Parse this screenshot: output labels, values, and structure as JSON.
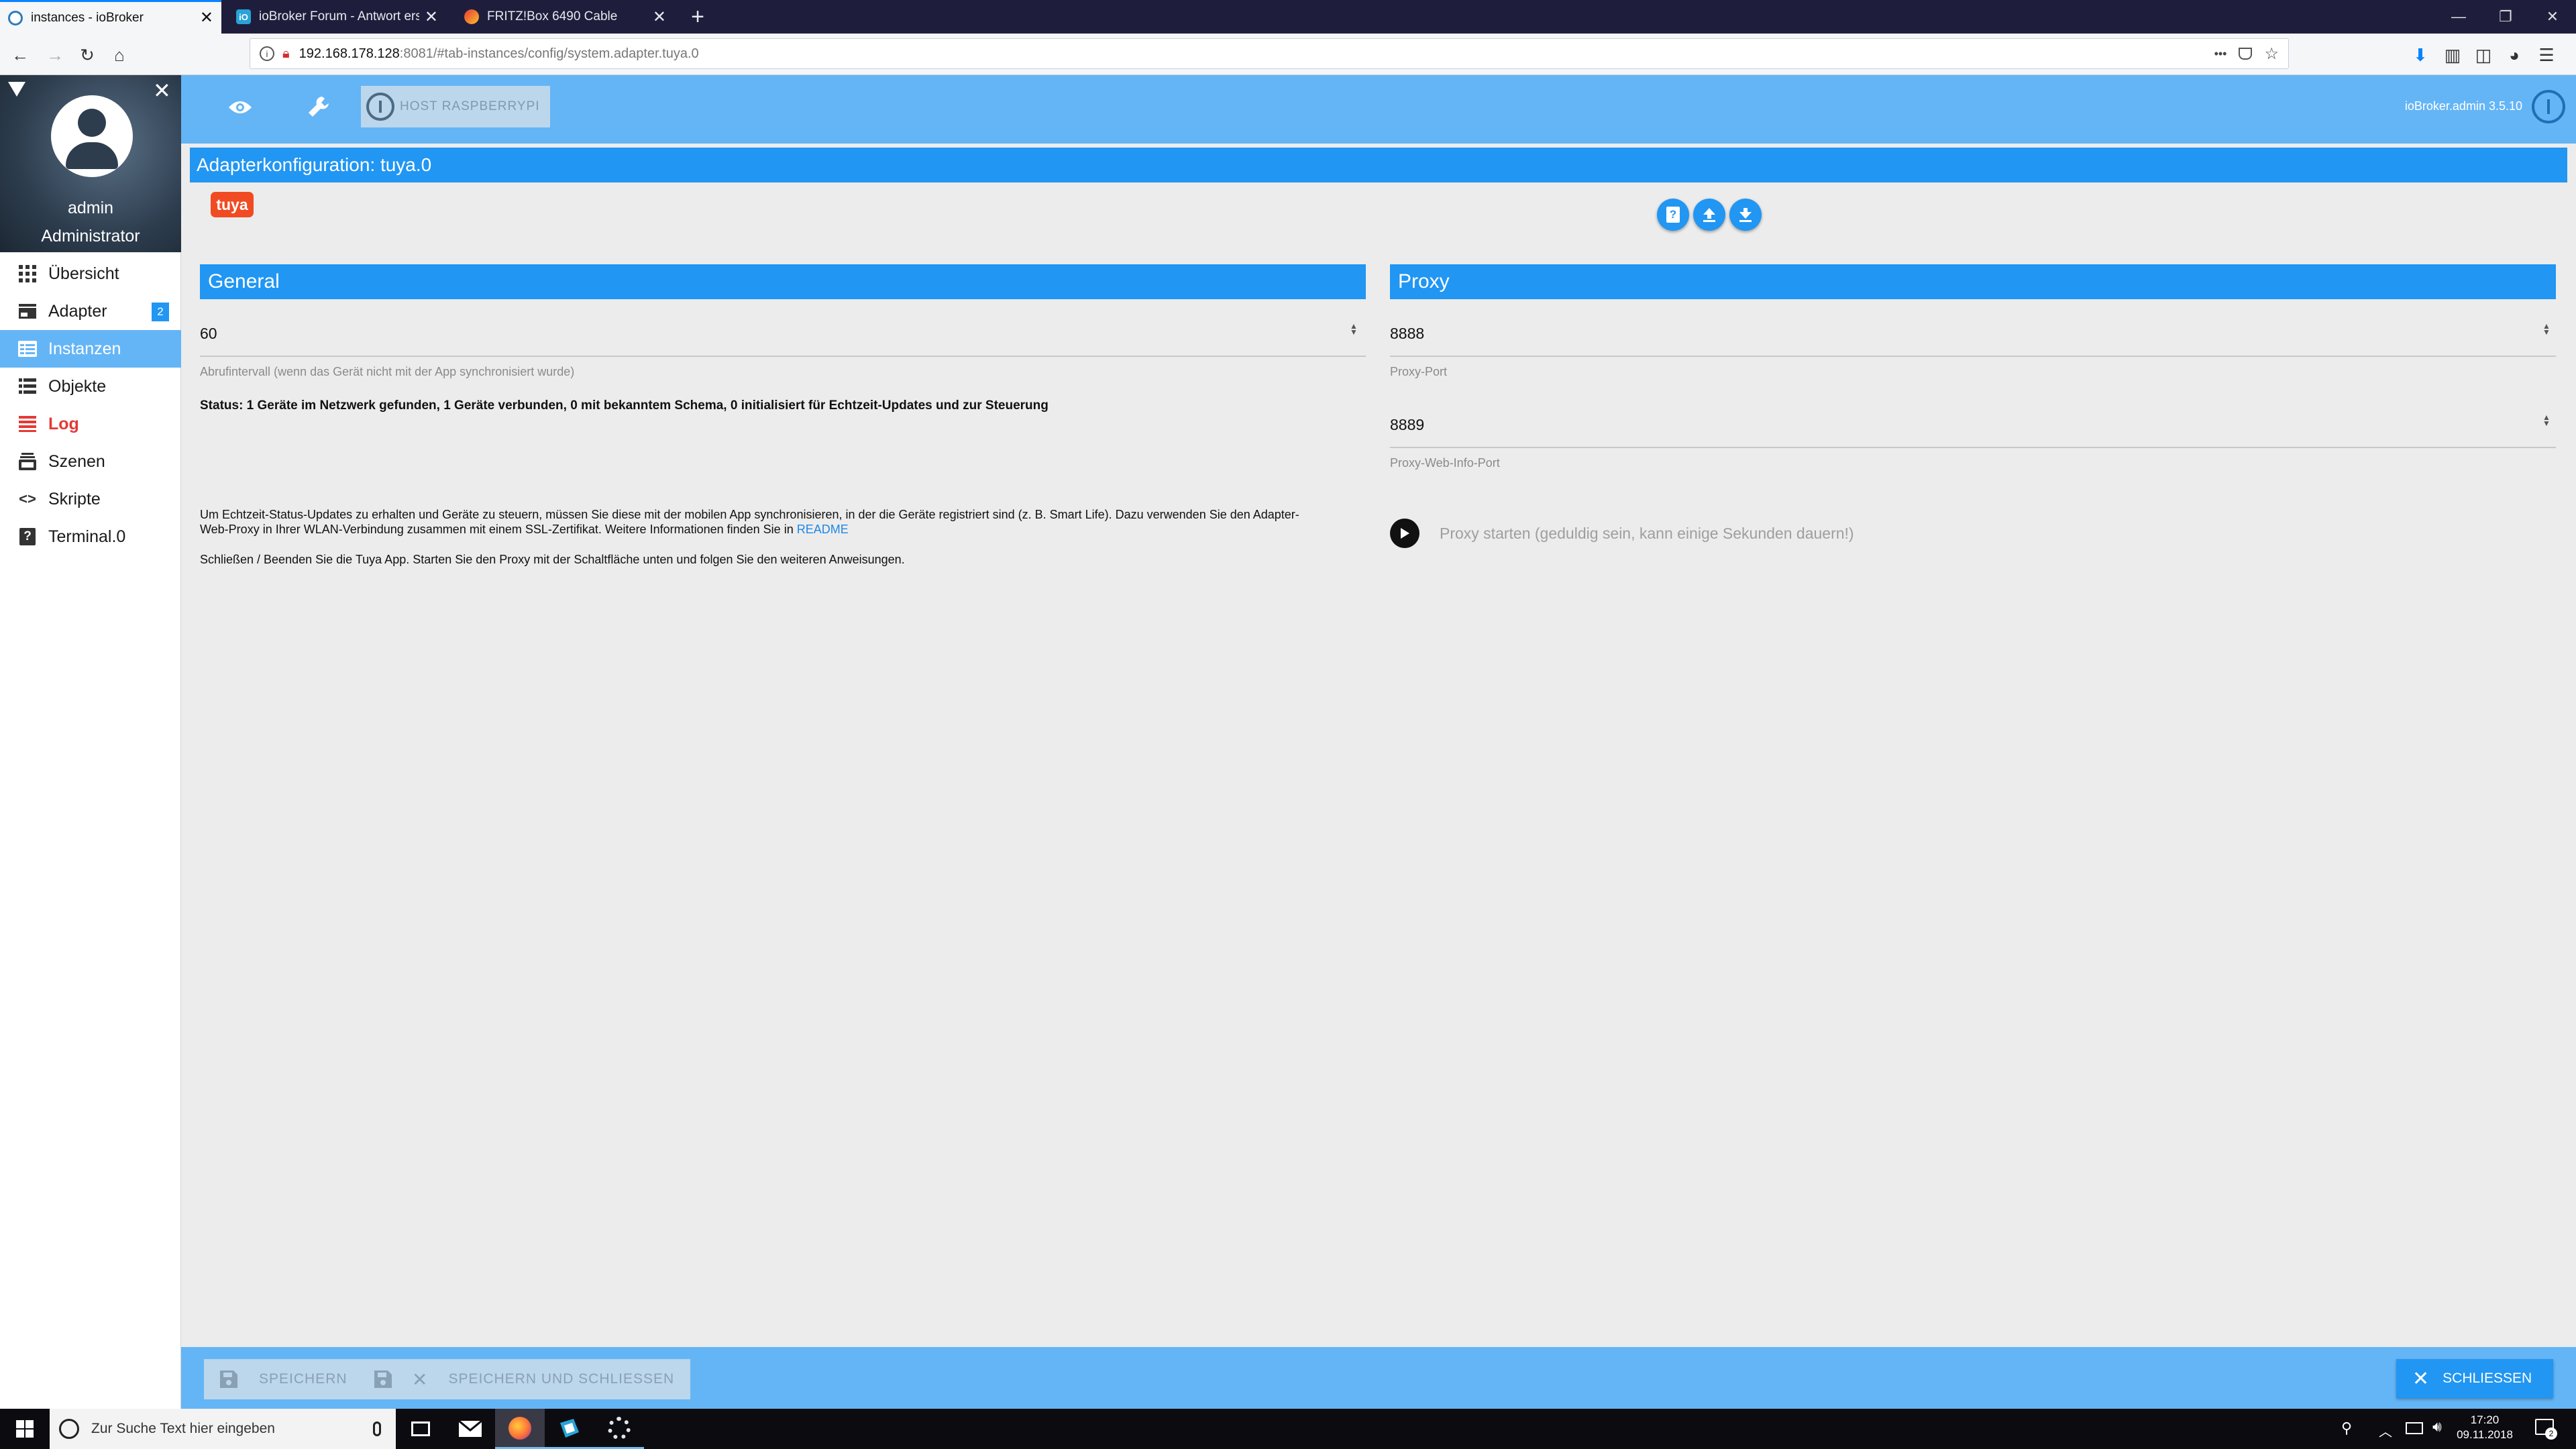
{
  "browser": {
    "tabs": [
      {
        "title": "instances - ioBroker",
        "active": true
      },
      {
        "title": "ioBroker Forum - Antwort erste",
        "active": false
      },
      {
        "title": "FRITZ!Box 6490 Cable",
        "active": false
      }
    ],
    "new_tab": "+",
    "url_host": "192.168.178.128",
    "url_rest": ":8081/#tab-instances/config/system.adapter.tuya.0",
    "url_more": "•••"
  },
  "sidebar": {
    "user_name": "admin",
    "user_role": "Administrator",
    "items": [
      {
        "label": "Übersicht",
        "icon": "grid-icon",
        "active": false
      },
      {
        "label": "Adapter",
        "icon": "store-icon",
        "active": false,
        "badge": "2"
      },
      {
        "label": "Instanzen",
        "icon": "instances-icon",
        "active": true
      },
      {
        "label": "Objekte",
        "icon": "list-icon",
        "active": false
      },
      {
        "label": "Log",
        "icon": "log-icon",
        "active": false,
        "color": "#e53935"
      },
      {
        "label": "Szenen",
        "icon": "scenes-icon",
        "active": false
      },
      {
        "label": "Skripte",
        "icon": "code-icon",
        "active": false
      },
      {
        "label": "Terminal.0",
        "icon": "help-icon",
        "active": false
      }
    ]
  },
  "appbar": {
    "host_label": "HOST RASPBERRYPI",
    "version": "ioBroker.admin 3.5.10"
  },
  "page": {
    "title": "Adapterkonfiguration: tuya.0",
    "logo_text": "tuya"
  },
  "general": {
    "header": "General",
    "interval_value": "60",
    "interval_label": "Abrufintervall (wenn das Gerät nicht mit der App synchronisiert wurde)",
    "status": "Status: 1 Geräte im Netzwerk gefunden, 1 Geräte verbunden, 0 mit bekanntem Schema, 0 initialisiert für Echtzeit-Updates und zur Steuerung",
    "info_line1": "Um Echtzeit-Status-Updates zu erhalten und Geräte zu steuern, müssen Sie diese mit der mobilen App synchronisieren, in der die Geräte registriert sind (z. B. Smart Life). Dazu verwenden Sie den Adapter-",
    "info_line2": "Web-Proxy in Ihrer WLAN-Verbindung zusammen mit einem SSL-Zertifikat. Weitere Informationen finden Sie in",
    "readme_link": "README",
    "info_close": "Schließen / Beenden Sie die Tuya App. Starten Sie den Proxy mit der Schaltfläche unten und folgen Sie den weiteren Anweisungen."
  },
  "proxy": {
    "header": "Proxy",
    "port_value": "8888",
    "port_label": "Proxy-Port",
    "web_port_value": "8889",
    "web_port_label": "Proxy-Web-Info-Port",
    "start_label": "Proxy starten (geduldig sein, kann einige Sekunden dauern!)"
  },
  "bottom": {
    "save": "SPEICHERN",
    "save_close": "SPEICHERN UND SCHLIESSEN",
    "close": "SCHLIESSEN"
  },
  "taskbar": {
    "search_placeholder": "Zur Suche Text hier eingeben",
    "time": "17:20",
    "date": "09.11.2018",
    "notification_count": "2"
  },
  "colors": {
    "primary": "#2196f3",
    "appbar": "#64b5f6",
    "tuya_logo": "#f04b23"
  }
}
